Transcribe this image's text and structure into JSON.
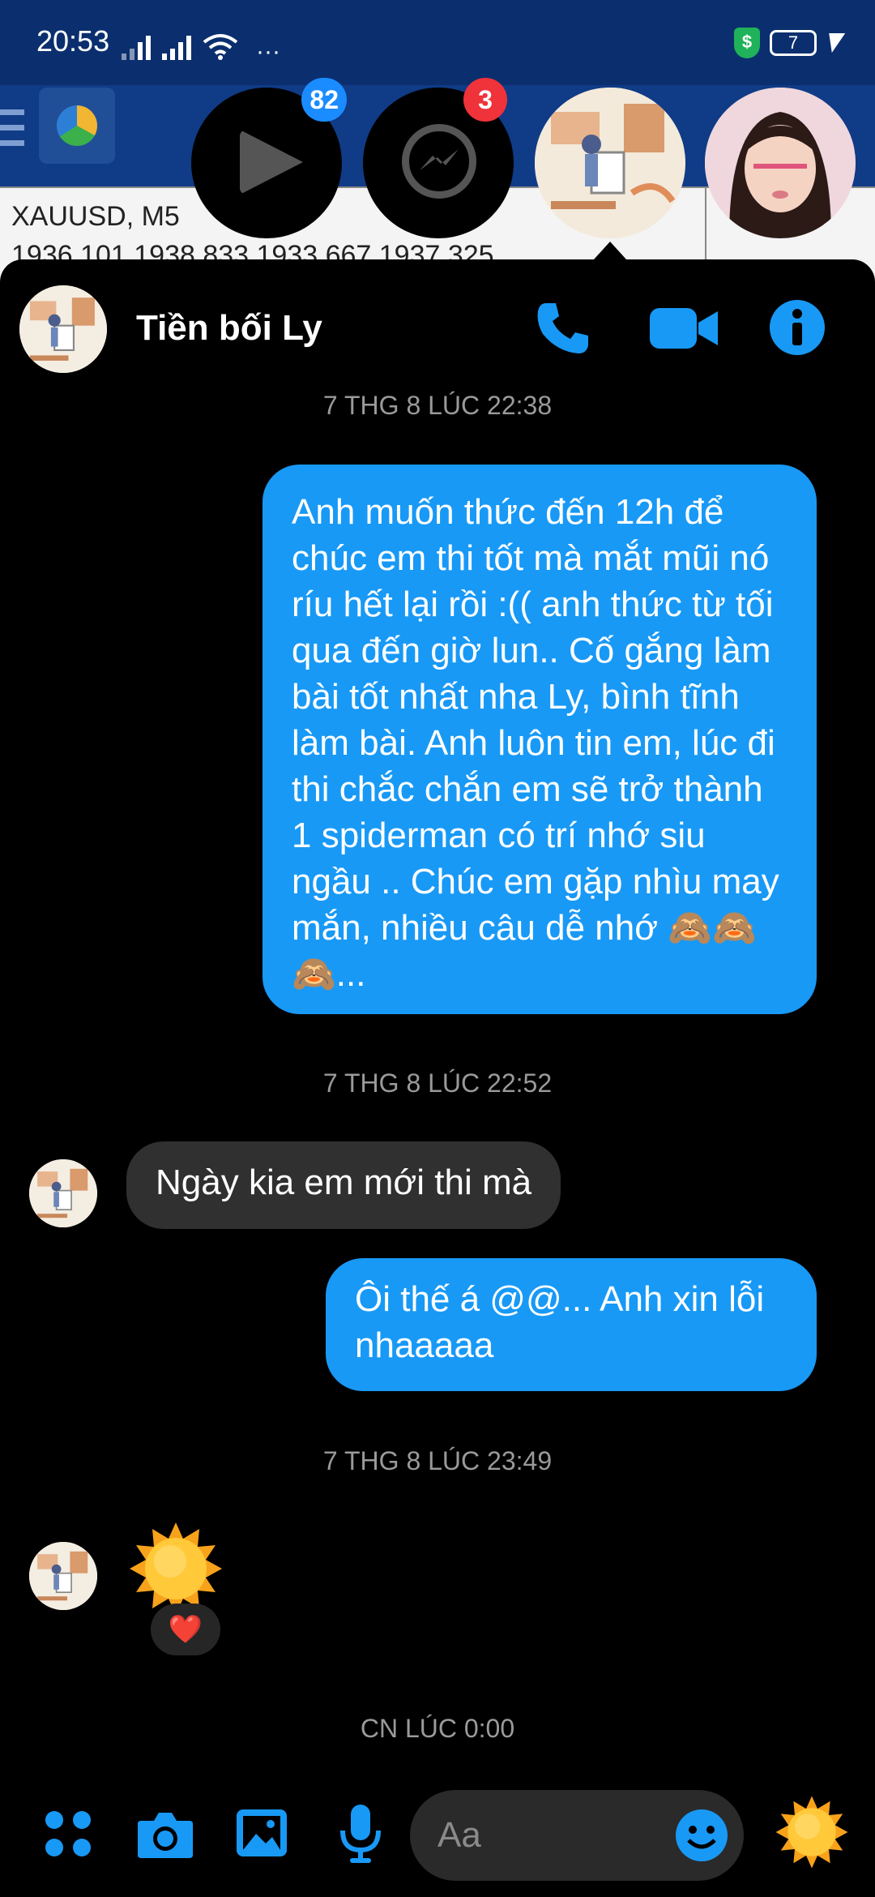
{
  "status_bar": {
    "time": "20:53",
    "battery": "7",
    "more": "···"
  },
  "background_app": {
    "chart_title": "XAUUSD, M5",
    "chart_values": "1936.101 1938.833 1933.667 1937.325"
  },
  "chat_heads": {
    "play_badge": "82",
    "messenger_badge": "3"
  },
  "chat": {
    "contact_name": "Tiền bối Ly",
    "messages": [
      {
        "type": "timestamp",
        "text": "7 THG 8 LÚC 22:38"
      },
      {
        "type": "outgoing",
        "text": "Anh muốn thức đến 12h để chúc em thi tốt mà mắt mũi nó ríu hết lại rồi :(( anh thức từ tối qua đến giờ lun.. Cố gắng làm bài tốt nhất nha Ly, bình tĩnh làm bài. Anh luôn tin em, lúc đi thi chắc chắn em sẽ trở thành 1 spiderman có trí nhớ siu ngầu .. Chúc em gặp nhìu may mắn, nhiều câu dễ nhớ 🙈🙈🙈..."
      },
      {
        "type": "timestamp",
        "text": "7 THG 8 LÚC 22:52"
      },
      {
        "type": "incoming",
        "text": "Ngày kia em mới thi mà"
      },
      {
        "type": "outgoing",
        "text": "Ôi thế á @@... Anh xin lỗi nhaaaaa"
      },
      {
        "type": "timestamp",
        "text": "7 THG 8 LÚC 23:49"
      },
      {
        "type": "incoming_sticker",
        "sticker": "sun-sticker",
        "reaction": "❤️"
      },
      {
        "type": "timestamp",
        "text": "CN LÚC 0:00"
      }
    ]
  },
  "composer": {
    "placeholder": "Aa"
  },
  "colors": {
    "accent": "#1899f6",
    "incoming_bubble": "#303030",
    "background": "#000000"
  }
}
